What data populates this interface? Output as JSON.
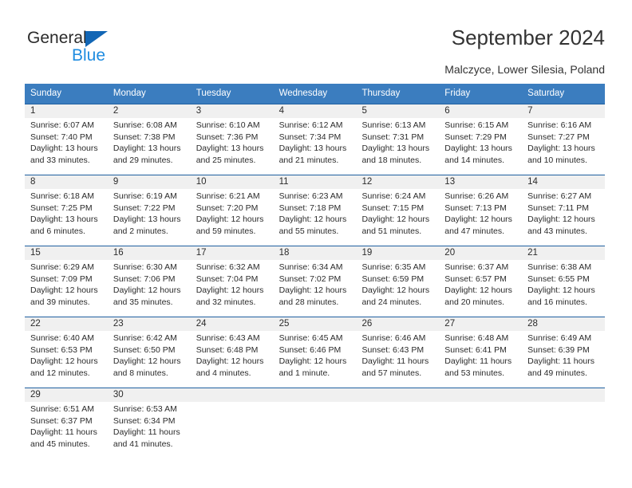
{
  "brand": {
    "name_dark": "General",
    "name_light": "Blue",
    "triangle_color": "#1266b5",
    "light_color": "#1f8ce0"
  },
  "header": {
    "title": "September 2024",
    "subtitle": "Malczyce, Lower Silesia, Poland"
  },
  "calendar": {
    "header_bg": "#3b7dbf",
    "row_line": "#1f5fa0",
    "daynum_bg": "#f0f0f0",
    "weekdays": [
      "Sunday",
      "Monday",
      "Tuesday",
      "Wednesday",
      "Thursday",
      "Friday",
      "Saturday"
    ],
    "weeks": [
      [
        {
          "day": "1",
          "sunrise": "Sunrise: 6:07 AM",
          "sunset": "Sunset: 7:40 PM",
          "daylight": "Daylight: 13 hours and 33 minutes."
        },
        {
          "day": "2",
          "sunrise": "Sunrise: 6:08 AM",
          "sunset": "Sunset: 7:38 PM",
          "daylight": "Daylight: 13 hours and 29 minutes."
        },
        {
          "day": "3",
          "sunrise": "Sunrise: 6:10 AM",
          "sunset": "Sunset: 7:36 PM",
          "daylight": "Daylight: 13 hours and 25 minutes."
        },
        {
          "day": "4",
          "sunrise": "Sunrise: 6:12 AM",
          "sunset": "Sunset: 7:34 PM",
          "daylight": "Daylight: 13 hours and 21 minutes."
        },
        {
          "day": "5",
          "sunrise": "Sunrise: 6:13 AM",
          "sunset": "Sunset: 7:31 PM",
          "daylight": "Daylight: 13 hours and 18 minutes."
        },
        {
          "day": "6",
          "sunrise": "Sunrise: 6:15 AM",
          "sunset": "Sunset: 7:29 PM",
          "daylight": "Daylight: 13 hours and 14 minutes."
        },
        {
          "day": "7",
          "sunrise": "Sunrise: 6:16 AM",
          "sunset": "Sunset: 7:27 PM",
          "daylight": "Daylight: 13 hours and 10 minutes."
        }
      ],
      [
        {
          "day": "8",
          "sunrise": "Sunrise: 6:18 AM",
          "sunset": "Sunset: 7:25 PM",
          "daylight": "Daylight: 13 hours and 6 minutes."
        },
        {
          "day": "9",
          "sunrise": "Sunrise: 6:19 AM",
          "sunset": "Sunset: 7:22 PM",
          "daylight": "Daylight: 13 hours and 2 minutes."
        },
        {
          "day": "10",
          "sunrise": "Sunrise: 6:21 AM",
          "sunset": "Sunset: 7:20 PM",
          "daylight": "Daylight: 12 hours and 59 minutes."
        },
        {
          "day": "11",
          "sunrise": "Sunrise: 6:23 AM",
          "sunset": "Sunset: 7:18 PM",
          "daylight": "Daylight: 12 hours and 55 minutes."
        },
        {
          "day": "12",
          "sunrise": "Sunrise: 6:24 AM",
          "sunset": "Sunset: 7:15 PM",
          "daylight": "Daylight: 12 hours and 51 minutes."
        },
        {
          "day": "13",
          "sunrise": "Sunrise: 6:26 AM",
          "sunset": "Sunset: 7:13 PM",
          "daylight": "Daylight: 12 hours and 47 minutes."
        },
        {
          "day": "14",
          "sunrise": "Sunrise: 6:27 AM",
          "sunset": "Sunset: 7:11 PM",
          "daylight": "Daylight: 12 hours and 43 minutes."
        }
      ],
      [
        {
          "day": "15",
          "sunrise": "Sunrise: 6:29 AM",
          "sunset": "Sunset: 7:09 PM",
          "daylight": "Daylight: 12 hours and 39 minutes."
        },
        {
          "day": "16",
          "sunrise": "Sunrise: 6:30 AM",
          "sunset": "Sunset: 7:06 PM",
          "daylight": "Daylight: 12 hours and 35 minutes."
        },
        {
          "day": "17",
          "sunrise": "Sunrise: 6:32 AM",
          "sunset": "Sunset: 7:04 PM",
          "daylight": "Daylight: 12 hours and 32 minutes."
        },
        {
          "day": "18",
          "sunrise": "Sunrise: 6:34 AM",
          "sunset": "Sunset: 7:02 PM",
          "daylight": "Daylight: 12 hours and 28 minutes."
        },
        {
          "day": "19",
          "sunrise": "Sunrise: 6:35 AM",
          "sunset": "Sunset: 6:59 PM",
          "daylight": "Daylight: 12 hours and 24 minutes."
        },
        {
          "day": "20",
          "sunrise": "Sunrise: 6:37 AM",
          "sunset": "Sunset: 6:57 PM",
          "daylight": "Daylight: 12 hours and 20 minutes."
        },
        {
          "day": "21",
          "sunrise": "Sunrise: 6:38 AM",
          "sunset": "Sunset: 6:55 PM",
          "daylight": "Daylight: 12 hours and 16 minutes."
        }
      ],
      [
        {
          "day": "22",
          "sunrise": "Sunrise: 6:40 AM",
          "sunset": "Sunset: 6:53 PM",
          "daylight": "Daylight: 12 hours and 12 minutes."
        },
        {
          "day": "23",
          "sunrise": "Sunrise: 6:42 AM",
          "sunset": "Sunset: 6:50 PM",
          "daylight": "Daylight: 12 hours and 8 minutes."
        },
        {
          "day": "24",
          "sunrise": "Sunrise: 6:43 AM",
          "sunset": "Sunset: 6:48 PM",
          "daylight": "Daylight: 12 hours and 4 minutes."
        },
        {
          "day": "25",
          "sunrise": "Sunrise: 6:45 AM",
          "sunset": "Sunset: 6:46 PM",
          "daylight": "Daylight: 12 hours and 1 minute."
        },
        {
          "day": "26",
          "sunrise": "Sunrise: 6:46 AM",
          "sunset": "Sunset: 6:43 PM",
          "daylight": "Daylight: 11 hours and 57 minutes."
        },
        {
          "day": "27",
          "sunrise": "Sunrise: 6:48 AM",
          "sunset": "Sunset: 6:41 PM",
          "daylight": "Daylight: 11 hours and 53 minutes."
        },
        {
          "day": "28",
          "sunrise": "Sunrise: 6:49 AM",
          "sunset": "Sunset: 6:39 PM",
          "daylight": "Daylight: 11 hours and 49 minutes."
        }
      ],
      [
        {
          "day": "29",
          "sunrise": "Sunrise: 6:51 AM",
          "sunset": "Sunset: 6:37 PM",
          "daylight": "Daylight: 11 hours and 45 minutes."
        },
        {
          "day": "30",
          "sunrise": "Sunrise: 6:53 AM",
          "sunset": "Sunset: 6:34 PM",
          "daylight": "Daylight: 11 hours and 41 minutes."
        },
        {
          "day": "",
          "sunrise": "",
          "sunset": "",
          "daylight": ""
        },
        {
          "day": "",
          "sunrise": "",
          "sunset": "",
          "daylight": ""
        },
        {
          "day": "",
          "sunrise": "",
          "sunset": "",
          "daylight": ""
        },
        {
          "day": "",
          "sunrise": "",
          "sunset": "",
          "daylight": ""
        },
        {
          "day": "",
          "sunrise": "",
          "sunset": "",
          "daylight": ""
        }
      ]
    ]
  }
}
